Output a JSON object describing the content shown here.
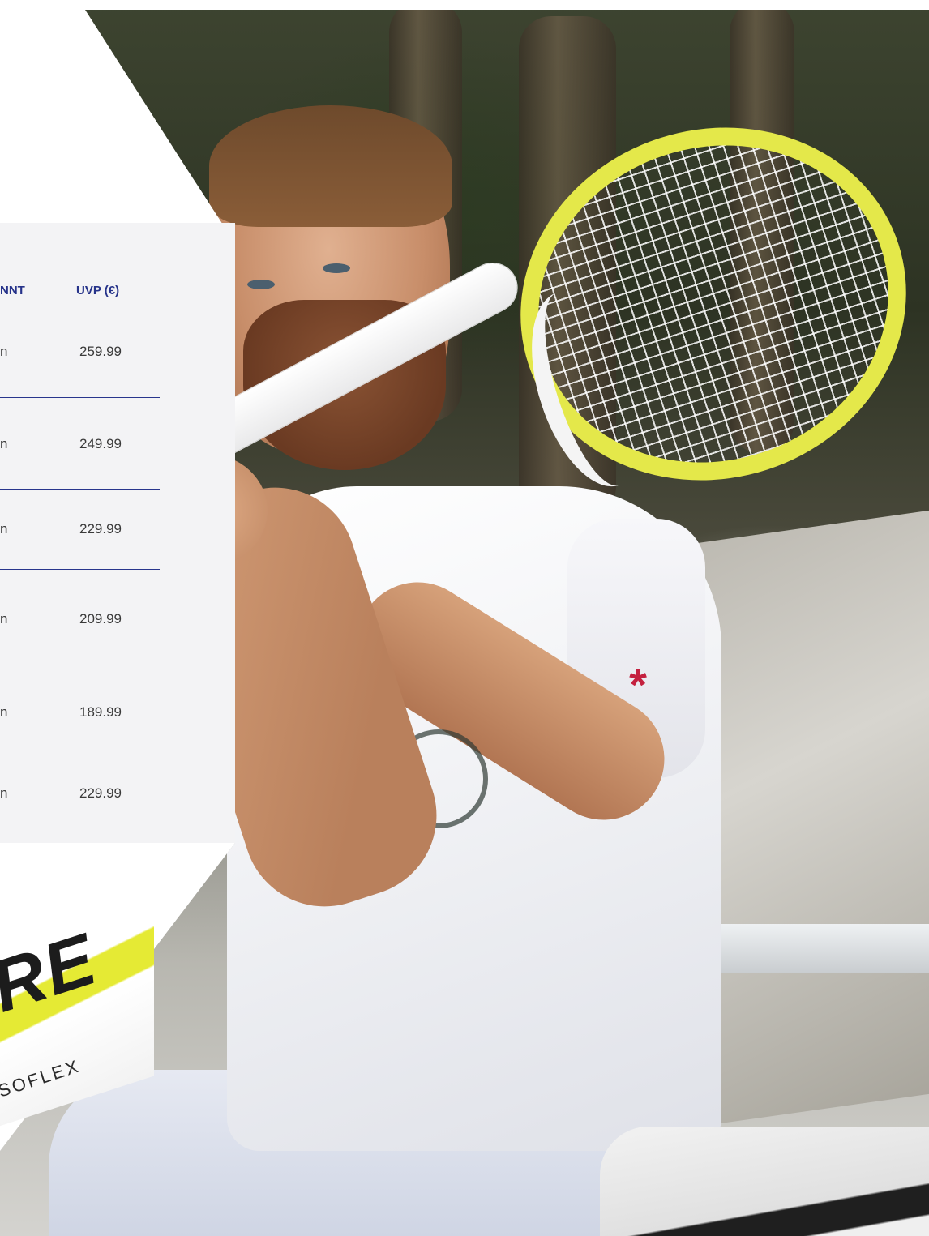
{
  "price_table": {
    "headers": {
      "name": "NNT",
      "price": "UVP (€)"
    },
    "rows": [
      {
        "name_fragment": "n",
        "price": "259.99"
      },
      {
        "name_fragment": "n",
        "price": "249.99"
      },
      {
        "name_fragment": "n",
        "price": "229.99"
      },
      {
        "name_fragment": "n",
        "price": "209.99"
      },
      {
        "name_fragment": "n",
        "price": "189.99"
      },
      {
        "name_fragment": "n",
        "price": "229.99"
      }
    ]
  },
  "closeup": {
    "brand_text": "RE",
    "model_text": "SOFLEX"
  },
  "shirt_logo": "*",
  "colors": {
    "header_text": "#26338a",
    "divider": "#28358c",
    "racket_yellow": "#e4e84a",
    "panel_bg": "#f3f3f5",
    "logo_red": "#c4213f"
  }
}
